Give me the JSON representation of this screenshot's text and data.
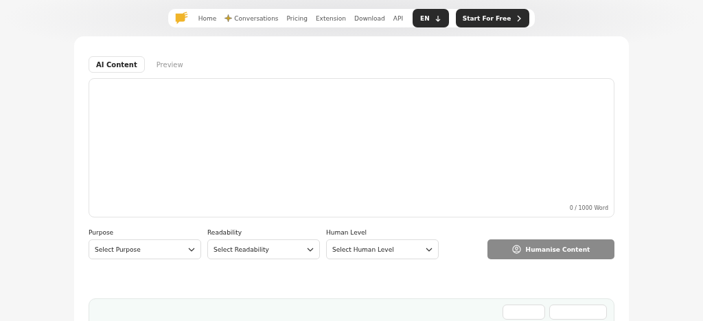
{
  "nav": {
    "items": [
      {
        "label": "Home",
        "icon": false
      },
      {
        "label": "Conversations",
        "icon": true
      },
      {
        "label": "Pricing",
        "icon": false
      },
      {
        "label": "Extension",
        "icon": false
      },
      {
        "label": "Download",
        "icon": false
      },
      {
        "label": "API",
        "icon": false
      }
    ],
    "language": "EN",
    "cta": "Start For Free"
  },
  "tabs": [
    {
      "label": "AI Content",
      "selected": true
    },
    {
      "label": "Preview",
      "selected": false
    }
  ],
  "editor": {
    "counter": "0 / 1000 Word"
  },
  "selects": [
    {
      "label": "Purpose",
      "placeholder": "Select Purpose"
    },
    {
      "label": "Readability",
      "placeholder": "Select Readability"
    },
    {
      "label": "Human Level",
      "placeholder": "Select Human Level"
    }
  ],
  "action": {
    "label": "Humanise Content",
    "disabled": true
  }
}
